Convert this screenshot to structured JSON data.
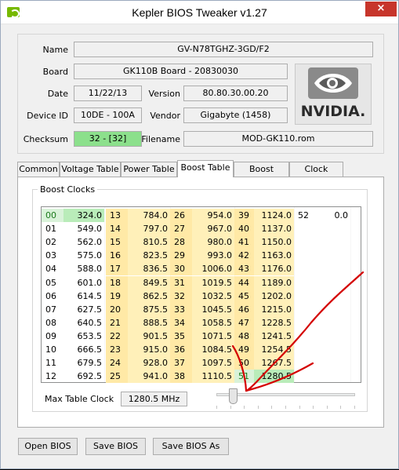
{
  "window": {
    "title": "Kepler BIOS Tweaker v1.27",
    "close_glyph": "×"
  },
  "info": {
    "name_label": "Name",
    "name_value": "GV-N78TGHZ-3GD/F2",
    "board_label": "Board",
    "board_value": "GK110B Board - 20830030",
    "date_label": "Date",
    "date_value": "11/22/13",
    "version_label": "Version",
    "version_value": "80.80.30.00.20",
    "device_id_label": "Device ID",
    "device_id_value": "10DE - 100A",
    "vendor_label": "Vendor",
    "vendor_value": "Gigabyte (1458)",
    "checksum_label": "Checksum",
    "checksum_value": "32 - [32]",
    "filename_label": "Filename",
    "filename_value": "MOD-GK110.rom",
    "logo_text": "NVIDIA."
  },
  "tabs": [
    {
      "label": "Common"
    },
    {
      "label": "Voltage Table"
    },
    {
      "label": "Power Table"
    },
    {
      "label": "Boost Table"
    },
    {
      "label": "Boost States"
    },
    {
      "label": "Clock States"
    }
  ],
  "active_tab": "Boost Table",
  "boost_clocks": {
    "title": "Boost Clocks",
    "columns": [
      {
        "rows": [
          [
            "00",
            "324.0"
          ],
          [
            "01",
            "549.0"
          ],
          [
            "02",
            "562.0"
          ],
          [
            "03",
            "575.0"
          ],
          [
            "04",
            "588.0"
          ],
          [
            "05",
            "601.0"
          ],
          [
            "06",
            "614.5"
          ],
          [
            "07",
            "627.5"
          ],
          [
            "08",
            "640.5"
          ],
          [
            "09",
            "653.5"
          ],
          [
            "10",
            "666.5"
          ],
          [
            "11",
            "679.5"
          ],
          [
            "12",
            "692.5"
          ]
        ]
      },
      {
        "rows": [
          [
            "13",
            "784.0"
          ],
          [
            "14",
            "797.0"
          ],
          [
            "15",
            "810.5"
          ],
          [
            "16",
            "823.5"
          ],
          [
            "17",
            "836.5"
          ],
          [
            "18",
            "849.5"
          ],
          [
            "19",
            "862.5"
          ],
          [
            "20",
            "875.5"
          ],
          [
            "21",
            "888.5"
          ],
          [
            "22",
            "901.5"
          ],
          [
            "23",
            "915.0"
          ],
          [
            "24",
            "928.0"
          ],
          [
            "25",
            "941.0"
          ]
        ]
      },
      {
        "rows": [
          [
            "26",
            "954.0"
          ],
          [
            "27",
            "967.0"
          ],
          [
            "28",
            "980.0"
          ],
          [
            "29",
            "993.0"
          ],
          [
            "30",
            "1006.0"
          ],
          [
            "31",
            "1019.5"
          ],
          [
            "32",
            "1032.5"
          ],
          [
            "33",
            "1045.5"
          ],
          [
            "34",
            "1058.5"
          ],
          [
            "35",
            "1071.5"
          ],
          [
            "36",
            "1084.5"
          ],
          [
            "37",
            "1097.5"
          ],
          [
            "38",
            "1110.5"
          ]
        ]
      },
      {
        "rows": [
          [
            "39",
            "1124.0"
          ],
          [
            "40",
            "1137.0"
          ],
          [
            "41",
            "1150.0"
          ],
          [
            "42",
            "1163.0"
          ],
          [
            "43",
            "1176.0"
          ],
          [
            "44",
            "1189.0"
          ],
          [
            "45",
            "1202.0"
          ],
          [
            "46",
            "1215.0"
          ],
          [
            "47",
            "1228.5"
          ],
          [
            "48",
            "1241.5"
          ],
          [
            "49",
            "1254.5"
          ],
          [
            "50",
            "1267.5"
          ],
          [
            "51",
            "1280.5"
          ]
        ]
      },
      {
        "rows": [
          [
            "52",
            "0.0"
          ]
        ]
      }
    ],
    "selected_low": "00",
    "selected_high": "51",
    "max_table_clock_label": "Max Table Clock",
    "max_table_clock_value": "1280.5 MHz",
    "slider_fraction": 0.1
  },
  "buttons": {
    "open": "Open BIOS",
    "save": "Save BIOS",
    "save_as": "Save BIOS As"
  },
  "colors": {
    "highlight_yellow": "#fff0b9",
    "selected_green": "#b9ecb9",
    "annotation_red": "#d40000",
    "nvidia_green": "#77b900"
  }
}
